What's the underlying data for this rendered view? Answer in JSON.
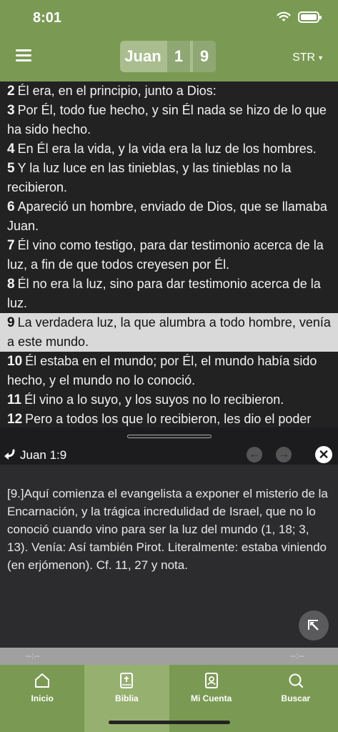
{
  "status": {
    "time": "8:01"
  },
  "header": {
    "book": "Juan",
    "chapter": "1",
    "verse": "9",
    "version": "STR"
  },
  "verses": [
    {
      "num": "2",
      "text": "Él era, en el principio, junto a Dios:"
    },
    {
      "num": "3",
      "text": "Por Él, todo fue hecho, y sin Él nada se hizo de lo que ha sido hecho."
    },
    {
      "num": "4",
      "text": "En Él era la vida, y la vida era la luz de los hombres."
    },
    {
      "num": "5",
      "text": "Y la luz luce en las tinieblas, y las tinieblas no la recibieron."
    },
    {
      "num": "6",
      "text": "Apareció un hombre, enviado de Dios, que se llamaba Juan."
    },
    {
      "num": "7",
      "text": "Él vino como testigo, para dar testimonio acerca de la luz, a fin de que todos creyesen por Él."
    },
    {
      "num": "8",
      "text": "Él no era la luz, sino para dar testimonio acerca de la luz."
    },
    {
      "num": "9",
      "text": "La verdadera luz, la que alumbra a todo hombre, venía a este mundo."
    },
    {
      "num": "10",
      "text": "Él estaba en el mundo; por Él, el mundo había sido hecho, y el mundo no lo conoció."
    },
    {
      "num": "11",
      "text": "Él vino a lo suyo, y los suyos no lo recibieron."
    },
    {
      "num": "12",
      "text": "Pero a todos los que lo recibieron, les dio el poder"
    }
  ],
  "note": {
    "reference": "Juan 1:9",
    "text": "[9.]Aquí comienza el evangelista a exponer el misterio de la Encarnación, y la trágica incredulidad de Israel, que no lo conoció cuando vino para ser la luz del mundo (1, 18; 3, 13). Venía: Así también Pirot. Literalmente: estaba viniendo (en erjómenon). Cf. 11, 27 y nota."
  },
  "audio": {
    "elapsed": "--:--",
    "total": "--:--"
  },
  "tabs": [
    {
      "label": "Inicio",
      "icon": "home-icon"
    },
    {
      "label": "Biblia",
      "icon": "bible-icon"
    },
    {
      "label": "Mi Cuenta",
      "icon": "account-icon"
    },
    {
      "label": "Buscar",
      "icon": "search-icon"
    }
  ],
  "colors": {
    "brand_green": "#7a9a53",
    "active_tab": "#96b06f",
    "highlight": "#d9d9d9"
  }
}
